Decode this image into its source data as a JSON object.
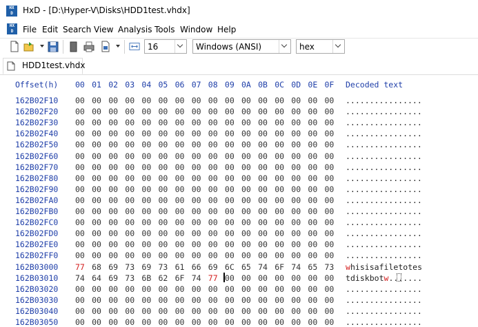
{
  "window": {
    "title": "HxD - [D:\\Hyper-V\\Disks\\HDD1test.vhdx]",
    "icon": "hxd-app-icon"
  },
  "menu": {
    "items": [
      "File",
      "Edit",
      "Search",
      "View",
      "Analysis",
      "Tools",
      "Window",
      "Help"
    ]
  },
  "toolbar": {
    "bytes_per_row": "16",
    "charset": "Windows (ANSI)",
    "offset_base": "hex",
    "icons": [
      "new-file-icon",
      "open-file-icon",
      "save-icon",
      "erase-icon",
      "print-icon",
      "export-icon",
      "bytes-per-row-icon"
    ]
  },
  "tab": {
    "label": "HDD1test.vhdx"
  },
  "hexview": {
    "offset_header": "Offset(h)",
    "column_headers": [
      "00",
      "01",
      "02",
      "03",
      "04",
      "05",
      "06",
      "07",
      "08",
      "09",
      "0A",
      "0B",
      "0C",
      "0D",
      "0E",
      "0F"
    ],
    "decoded_header": "Decoded text",
    "rows": [
      {
        "offset": "162B02F10",
        "bytes": [
          "00",
          "00",
          "00",
          "00",
          "00",
          "00",
          "00",
          "00",
          "00",
          "00",
          "00",
          "00",
          "00",
          "00",
          "00",
          "00"
        ],
        "decoded": "................"
      },
      {
        "offset": "162B02F20",
        "bytes": [
          "00",
          "00",
          "00",
          "00",
          "00",
          "00",
          "00",
          "00",
          "00",
          "00",
          "00",
          "00",
          "00",
          "00",
          "00",
          "00"
        ],
        "decoded": "................"
      },
      {
        "offset": "162B02F30",
        "bytes": [
          "00",
          "00",
          "00",
          "00",
          "00",
          "00",
          "00",
          "00",
          "00",
          "00",
          "00",
          "00",
          "00",
          "00",
          "00",
          "00"
        ],
        "decoded": "................"
      },
      {
        "offset": "162B02F40",
        "bytes": [
          "00",
          "00",
          "00",
          "00",
          "00",
          "00",
          "00",
          "00",
          "00",
          "00",
          "00",
          "00",
          "00",
          "00",
          "00",
          "00"
        ],
        "decoded": "................"
      },
      {
        "offset": "162B02F50",
        "bytes": [
          "00",
          "00",
          "00",
          "00",
          "00",
          "00",
          "00",
          "00",
          "00",
          "00",
          "00",
          "00",
          "00",
          "00",
          "00",
          "00"
        ],
        "decoded": "................"
      },
      {
        "offset": "162B02F60",
        "bytes": [
          "00",
          "00",
          "00",
          "00",
          "00",
          "00",
          "00",
          "00",
          "00",
          "00",
          "00",
          "00",
          "00",
          "00",
          "00",
          "00"
        ],
        "decoded": "................"
      },
      {
        "offset": "162B02F70",
        "bytes": [
          "00",
          "00",
          "00",
          "00",
          "00",
          "00",
          "00",
          "00",
          "00",
          "00",
          "00",
          "00",
          "00",
          "00",
          "00",
          "00"
        ],
        "decoded": "................"
      },
      {
        "offset": "162B02F80",
        "bytes": [
          "00",
          "00",
          "00",
          "00",
          "00",
          "00",
          "00",
          "00",
          "00",
          "00",
          "00",
          "00",
          "00",
          "00",
          "00",
          "00"
        ],
        "decoded": "................"
      },
      {
        "offset": "162B02F90",
        "bytes": [
          "00",
          "00",
          "00",
          "00",
          "00",
          "00",
          "00",
          "00",
          "00",
          "00",
          "00",
          "00",
          "00",
          "00",
          "00",
          "00"
        ],
        "decoded": "................"
      },
      {
        "offset": "162B02FA0",
        "bytes": [
          "00",
          "00",
          "00",
          "00",
          "00",
          "00",
          "00",
          "00",
          "00",
          "00",
          "00",
          "00",
          "00",
          "00",
          "00",
          "00"
        ],
        "decoded": "................"
      },
      {
        "offset": "162B02FB0",
        "bytes": [
          "00",
          "00",
          "00",
          "00",
          "00",
          "00",
          "00",
          "00",
          "00",
          "00",
          "00",
          "00",
          "00",
          "00",
          "00",
          "00"
        ],
        "decoded": "................"
      },
      {
        "offset": "162B02FC0",
        "bytes": [
          "00",
          "00",
          "00",
          "00",
          "00",
          "00",
          "00",
          "00",
          "00",
          "00",
          "00",
          "00",
          "00",
          "00",
          "00",
          "00"
        ],
        "decoded": "................"
      },
      {
        "offset": "162B02FD0",
        "bytes": [
          "00",
          "00",
          "00",
          "00",
          "00",
          "00",
          "00",
          "00",
          "00",
          "00",
          "00",
          "00",
          "00",
          "00",
          "00",
          "00"
        ],
        "decoded": "................"
      },
      {
        "offset": "162B02FE0",
        "bytes": [
          "00",
          "00",
          "00",
          "00",
          "00",
          "00",
          "00",
          "00",
          "00",
          "00",
          "00",
          "00",
          "00",
          "00",
          "00",
          "00"
        ],
        "decoded": "................"
      },
      {
        "offset": "162B02FF0",
        "bytes": [
          "00",
          "00",
          "00",
          "00",
          "00",
          "00",
          "00",
          "00",
          "00",
          "00",
          "00",
          "00",
          "00",
          "00",
          "00",
          "00"
        ],
        "decoded": "................"
      },
      {
        "offset": "162B03000",
        "bytes": [
          "77",
          "68",
          "69",
          "73",
          "69",
          "73",
          "61",
          "66",
          "69",
          "6C",
          "65",
          "74",
          "6F",
          "74",
          "65",
          "73"
        ],
        "decoded": "whisisafiletotes",
        "changed": [
          0
        ],
        "decoded_hl": [
          0
        ]
      },
      {
        "offset": "162B03010",
        "bytes": [
          "74",
          "64",
          "69",
          "73",
          "6B",
          "62",
          "6F",
          "74",
          "77",
          "00",
          "00",
          "00",
          "00",
          "00",
          "00",
          "00"
        ],
        "decoded": "tdiskbotw.......",
        "changed": [
          8
        ],
        "decoded_hl": [
          8
        ]
      },
      {
        "offset": "162B03020",
        "bytes": [
          "00",
          "00",
          "00",
          "00",
          "00",
          "00",
          "00",
          "00",
          "00",
          "00",
          "00",
          "00",
          "00",
          "00",
          "00",
          "00"
        ],
        "decoded": "................"
      },
      {
        "offset": "162B03030",
        "bytes": [
          "00",
          "00",
          "00",
          "00",
          "00",
          "00",
          "00",
          "00",
          "00",
          "00",
          "00",
          "00",
          "00",
          "00",
          "00",
          "00"
        ],
        "decoded": "................"
      },
      {
        "offset": "162B03040",
        "bytes": [
          "00",
          "00",
          "00",
          "00",
          "00",
          "00",
          "00",
          "00",
          "00",
          "00",
          "00",
          "00",
          "00",
          "00",
          "00",
          "00"
        ],
        "decoded": "................"
      },
      {
        "offset": "162B03050",
        "bytes": [
          "00",
          "00",
          "00",
          "00",
          "00",
          "00",
          "00",
          "00",
          "00",
          "00",
          "00",
          "00",
          "00",
          "00",
          "00",
          "00"
        ],
        "decoded": "................"
      }
    ]
  },
  "colors": {
    "offset_blue": "#1e3ea8",
    "changed_red": "#d42020",
    "byte_gray": "#333333"
  }
}
